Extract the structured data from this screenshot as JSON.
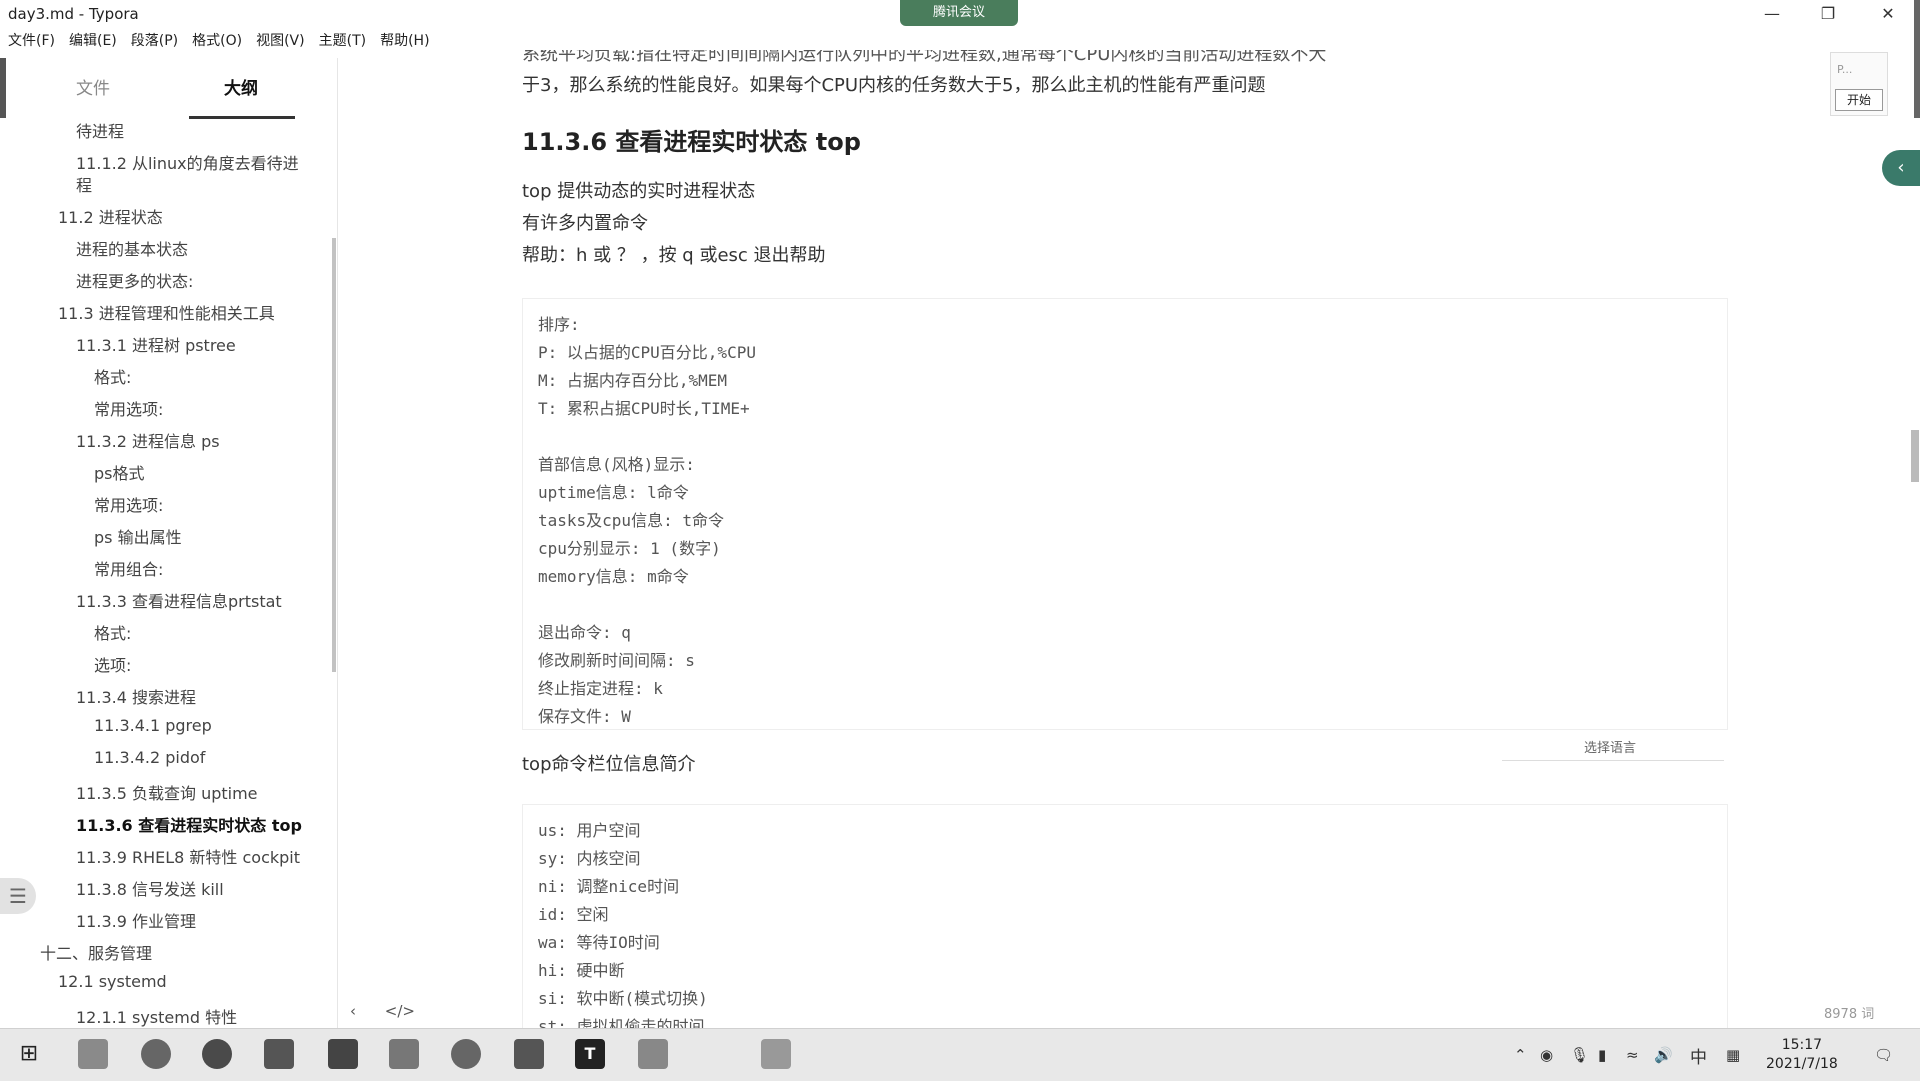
{
  "window": {
    "app_title": "day3.md - Typora",
    "meeting_badge": "腾讯会议"
  },
  "menu": [
    "文件(F)",
    "编辑(E)",
    "段落(P)",
    "格式(O)",
    "视图(V)",
    "主题(T)",
    "帮助(H)"
  ],
  "sidebar": {
    "tab_files": "文件",
    "tab_outline": "大纲",
    "outline_items": [
      {
        "label": "待进程"
      },
      {
        "label": "11.1.2 从linux的角度去看待进"
      },
      {
        "label": "程"
      },
      {
        "label": "11.2 进程状态"
      },
      {
        "label": "进程的基本状态"
      },
      {
        "label": "进程更多的状态:"
      },
      {
        "label": "11.3 进程管理和性能相关工具"
      },
      {
        "label": "11.3.1 进程树 pstree"
      },
      {
        "label": "格式:"
      },
      {
        "label": "常用选项:"
      },
      {
        "label": "11.3.2 进程信息 ps"
      },
      {
        "label": "ps格式"
      },
      {
        "label": "常用选项:"
      },
      {
        "label": "ps 输出属性"
      },
      {
        "label": "常用组合:"
      },
      {
        "label": "11.3.3 查看进程信息prtstat"
      },
      {
        "label": "格式:"
      },
      {
        "label": "选项:"
      },
      {
        "label": "11.3.4 搜索进程"
      },
      {
        "label": "11.3.4.1 pgrep"
      },
      {
        "label": "11.3.4.2 pidof"
      },
      {
        "label": "11.3.5 负载查询 uptime"
      },
      {
        "label": "11.3.6 查看进程实时状态 top",
        "active": true
      },
      {
        "label": "11.3.9 RHEL8 新特性 cockpit"
      },
      {
        "label": "11.3.8 信号发送 kill"
      },
      {
        "label": "11.3.9 作业管理"
      },
      {
        "label": "十二、服务管理"
      },
      {
        "label": "12.1 systemd"
      },
      {
        "label": "12.1.1 systemd 特性"
      }
    ]
  },
  "document": {
    "partial_line": "系统平均负载:指在特定时间间隔内运行队列中的平均进程数,通常每个CPU内核的当前活动进程数不大",
    "para_top": "于3，那么系统的性能良好。如果每个CPU内核的任务数大于5，那么此主机的性能有严重问题",
    "heading": "11.3.6 查看进程实时状态 top",
    "intro": [
      "top 提供动态的实时进程状态",
      "有许多内置命令",
      "帮助：h 或 ？ ，按 q 或esc 退出帮助"
    ],
    "code1": [
      "排序:",
      "P: 以占据的CPU百分比,%CPU",
      "M: 占据内存百分比,%MEM",
      "T: 累积占据CPU时长,TIME+",
      "",
      "首部信息(风格)显示:",
      "uptime信息: l命令",
      "tasks及cpu信息: t命令",
      "cpu分别显示: 1 (数字)",
      "memory信息: m命令",
      "",
      "退出命令: q",
      "修改刷新时间间隔: s",
      "终止指定进程: k",
      "保存文件: W"
    ],
    "lang_select": "选择语言",
    "section2": "top命令栏位信息简介",
    "code2": [
      "us: 用户空间",
      "sy: 内核空间",
      "ni: 调整nice时间",
      "id: 空闲",
      "wa: 等待IO时间",
      "hi: 硬中断",
      "si: 软中断(模式切换)",
      "st: 虚拟机偷走的时间"
    ],
    "word_count": "8978 词"
  },
  "pip": {
    "label": "P...",
    "start": "开始"
  },
  "taskbar": {
    "ime": "中",
    "time": "15:17",
    "date": "2021/7/18"
  }
}
